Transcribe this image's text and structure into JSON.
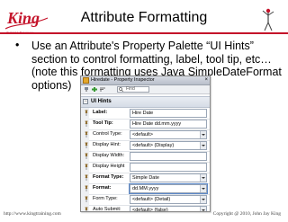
{
  "slide": {
    "logo_text": "King",
    "logo_subtitle": "Training Resources",
    "title": "Attribute Formatting",
    "bullet_char": "•",
    "bullet_lines": [
      "Use an Attribute's Property Palette “UI Hints”",
      "section to control formatting, label, tool tip, etc…",
      "(note this formatting uses Java SimpleDateFormat",
      "options)"
    ],
    "footer_left": "http://www.kingtraining.com",
    "footer_right": "Copyright @ 2010, John Jay King",
    "accent_color": "#c4132a"
  },
  "inspector": {
    "title": "Hiredate - Property Inspector",
    "close_glyph": "×",
    "toolbar": {
      "icons": [
        "pin-icon",
        "green-add-icon",
        "sort-icon"
      ],
      "find_label": "Find"
    },
    "section": {
      "toggle": "−",
      "label": "UI Hints"
    },
    "properties": [
      {
        "label": "Label:",
        "value": "Hire Date",
        "bold": true,
        "dropdown": false
      },
      {
        "label": "Tool Tip:",
        "value": "Hire Date dd.mm.yyyy",
        "bold": true,
        "dropdown": false
      },
      {
        "label": "Control Type:",
        "value": "<default>",
        "bold": false,
        "dropdown": true
      },
      {
        "label": "Display Hint:",
        "value": "<default> (Display)",
        "bold": false,
        "dropdown": true
      },
      {
        "label": "Display Width:",
        "value": "",
        "bold": false,
        "dropdown": false
      },
      {
        "label": "Display Height:",
        "value": "",
        "bold": false,
        "dropdown": false
      },
      {
        "label": "Format Type:",
        "value": "Simple Date",
        "bold": true,
        "dropdown": true
      },
      {
        "label": "Format:",
        "value": "dd.MM.yyyy",
        "bold": true,
        "dropdown": true
      },
      {
        "label": "Form Type:",
        "value": "<default> (Detail)",
        "bold": false,
        "dropdown": true
      },
      {
        "label": "Auto Submit:",
        "value": "<default> (false)",
        "bold": false,
        "dropdown": true
      }
    ]
  }
}
